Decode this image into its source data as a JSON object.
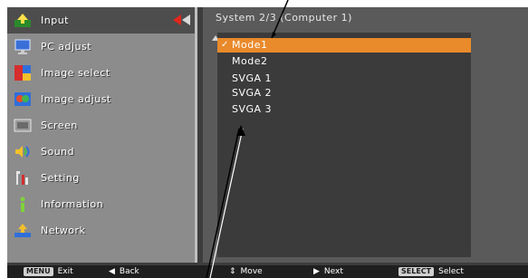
{
  "menu": {
    "items": [
      {
        "label": "Input",
        "icon": "input-icon",
        "selected": true
      },
      {
        "label": "PC adjust",
        "icon": "monitor-icon"
      },
      {
        "label": "Image select",
        "icon": "image-select-icon"
      },
      {
        "label": "Image adjust",
        "icon": "image-adjust-icon"
      },
      {
        "label": "Screen",
        "icon": "screen-icon"
      },
      {
        "label": "Sound",
        "icon": "sound-icon"
      },
      {
        "label": "Setting",
        "icon": "setting-icon"
      },
      {
        "label": "Information",
        "icon": "information-icon"
      },
      {
        "label": "Network",
        "icon": "network-icon"
      }
    ]
  },
  "submenu": {
    "title": "System 2/3 (Computer 1)",
    "options": [
      {
        "label": "Mode1",
        "checked": true,
        "highlighted": true
      },
      {
        "label": "Mode2"
      },
      {
        "label": "SVGA 1"
      },
      {
        "label": "SVGA 2"
      },
      {
        "label": "SVGA 3"
      }
    ]
  },
  "footer": {
    "exit_key": "MENU",
    "exit_label": "Exit",
    "back_label": "Back",
    "move_label": "Move",
    "next_label": "Next",
    "select_key": "SELECT",
    "select_label": "Select"
  },
  "colors": {
    "highlight": "#e98a2b",
    "selection_arrow": "#e0261b",
    "menu_bg": "#8c8c8c",
    "panel_bg": "#3d3d3d"
  }
}
